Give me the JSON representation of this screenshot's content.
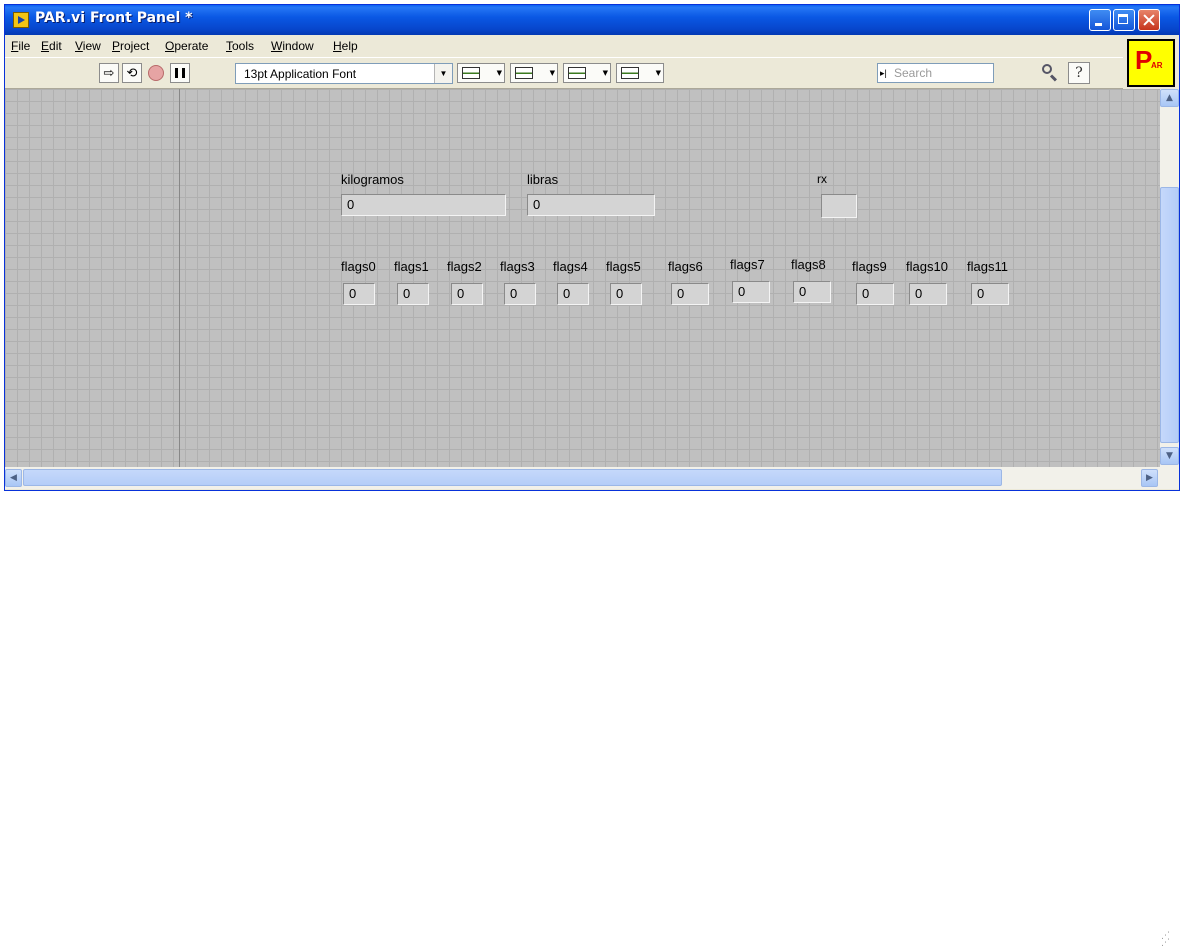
{
  "window": {
    "title": "PAR.vi Front Panel *",
    "buttons": [
      "minimize",
      "maximize",
      "close"
    ]
  },
  "menu": [
    {
      "label": "File",
      "mnemonic": "F",
      "rest": "ile"
    },
    {
      "label": "Edit",
      "mnemonic": "E",
      "rest": "dit"
    },
    {
      "label": "View",
      "mnemonic": "V",
      "rest": "iew"
    },
    {
      "label": "Project",
      "mnemonic": "P",
      "rest": "roject"
    },
    {
      "label": "Operate",
      "mnemonic": "O",
      "rest": "perate"
    },
    {
      "label": "Tools",
      "mnemonic": "T",
      "rest": "ools"
    },
    {
      "label": "Window",
      "mnemonic": "W",
      "rest": "indow"
    },
    {
      "label": "Help",
      "mnemonic": "H",
      "rest": "elp"
    }
  ],
  "toolbar": {
    "run_icon": "run-arrow-icon",
    "run_continuously_icon": "run-continuously-icon",
    "abort_icon": "abort-icon",
    "pause_icon": "pause-icon",
    "font": "13pt Application Font",
    "align_icon": "align-objects-icon",
    "distribute_icon": "distribute-objects-icon",
    "resize_icon": "resize-objects-icon",
    "reorder_icon": "reorder-icon",
    "search_placeholder": "Search",
    "help_icon": "context-help-icon",
    "help_label": "?"
  },
  "vi_icon": {
    "big": "P",
    "small": "AR"
  },
  "panel": {
    "kilogramos": {
      "label": "kilogramos",
      "value": "0"
    },
    "libras": {
      "label": "libras",
      "value": "0"
    },
    "rx": {
      "label": "rx",
      "value": ""
    },
    "flags": [
      {
        "label": "flags0",
        "value": "0"
      },
      {
        "label": "flags1",
        "value": "0"
      },
      {
        "label": "flags2",
        "value": "0"
      },
      {
        "label": "flags3",
        "value": "0"
      },
      {
        "label": "flags4",
        "value": "0"
      },
      {
        "label": "flags5",
        "value": "0"
      },
      {
        "label": "flags6",
        "value": "0"
      },
      {
        "label": "flags7",
        "value": "0"
      },
      {
        "label": "flags8",
        "value": "0"
      },
      {
        "label": "flags9",
        "value": "0"
      },
      {
        "label": "flags10",
        "value": "0"
      },
      {
        "label": "flags11",
        "value": "0"
      }
    ]
  },
  "colors": {
    "panel_background": "#c0c0c0",
    "grid_line": "#b0b0b0",
    "titlebar": "#0a58e4",
    "vi_icon_background": "#ffff00",
    "vi_icon_text": "#e00000"
  }
}
